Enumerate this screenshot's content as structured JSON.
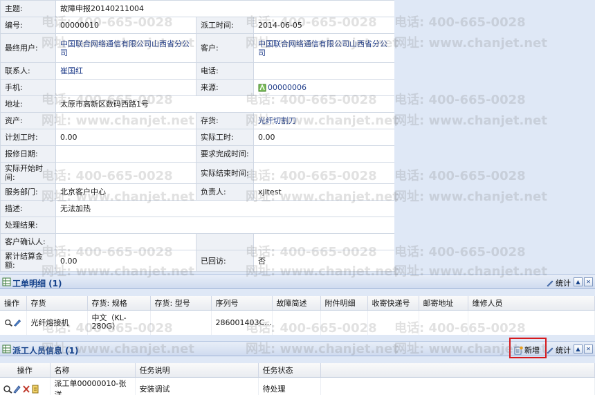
{
  "form": {
    "subject_label": "主题:",
    "subject_value": "故障申报20140211004",
    "number_label": "编号:",
    "number_value": "00000010",
    "dispatch_time_label": "派工时间:",
    "dispatch_time_value": "2014-06-05",
    "end_user_label": "最终用户:",
    "end_user_value": "中国联合网络通信有限公司山西省分公司",
    "customer_label": "客户:",
    "customer_value": "中国联合网络通信有限公司山西省分公司",
    "contact_label": "联系人:",
    "contact_value": "崔国红",
    "phone_label": "电话:",
    "phone_value": "",
    "mobile_label": "手机:",
    "mobile_value": "",
    "source_label": "来源:",
    "source_value": "00000006",
    "address_label": "地址:",
    "address_value": "太原市高新区数码西路1号",
    "asset_label": "资产:",
    "asset_value": "",
    "inventory_label": "存货:",
    "inventory_value": "光纤切割刀",
    "planned_hours_label": "计划工时:",
    "planned_hours_value": "0.00",
    "actual_hours_label": "实际工时:",
    "actual_hours_value": "0.00",
    "repair_date_label": "报修日期:",
    "repair_date_value": "",
    "required_finish_label": "要求完成时间:",
    "required_finish_value": "",
    "actual_start_label": "实际开始时间:",
    "actual_start_value": "",
    "actual_end_label": "实际结束时间:",
    "actual_end_value": "",
    "service_dept_label": "服务部门:",
    "service_dept_value": "北京客户中心",
    "owner_label": "负责人:",
    "owner_value": "xjltest",
    "description_label": "描述:",
    "description_value": "无法加热",
    "result_label": "处理结果:",
    "result_value": "",
    "confirm_label": "客户确认人:",
    "confirm_value": "",
    "settlement_label": "累计结算金额:",
    "settlement_value": "0.00",
    "visited_label": "已回访:",
    "visited_value": "否"
  },
  "detail_panel": {
    "title": "工单明细 (1)",
    "stats_label": "统计",
    "columns": [
      "操作",
      "存货",
      "存货: 规格",
      "存货: 型号",
      "序列号",
      "故障简述",
      "附件明细",
      "收寄快递号",
      "邮寄地址",
      "维修人员"
    ],
    "row": {
      "inventory": "光纤熔接机",
      "spec": "中文（KL-280G）",
      "model": "",
      "serial": "286001403C...",
      "fault": "",
      "attachment": "",
      "express": "",
      "address": "",
      "repairer": ""
    }
  },
  "staff_panel": {
    "title": "派工人员信息 (1)",
    "add_label": "新增",
    "stats_label": "统计",
    "columns": [
      "操作",
      "名称",
      "任务说明",
      "任务状态"
    ],
    "row": {
      "name": "派工单00000010-张洋",
      "task": "安装调试",
      "status": "待处理"
    }
  },
  "watermark": {
    "phone": "电话: 400-665-0028",
    "site": "网址: www.chanjet.net"
  },
  "colors": {
    "header_text": "#15428b",
    "link": "#1f3c8a",
    "highlight_border": "#d7191c"
  }
}
